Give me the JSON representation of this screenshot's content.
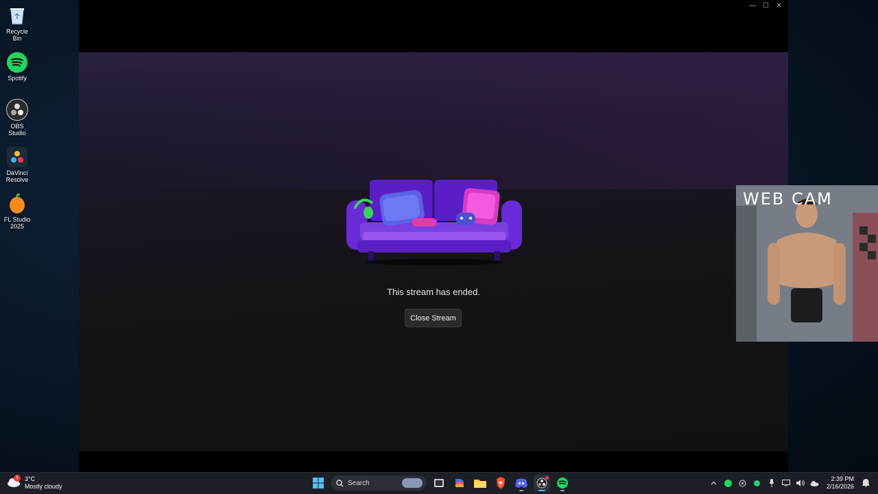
{
  "desktop": {
    "icons": [
      {
        "label": "Recycle Bin",
        "icon": "recycle-bin-icon"
      },
      {
        "label": "Spotify",
        "icon": "spotify-icon"
      },
      {
        "label": "OBS Studio",
        "icon": "obs-studio-icon"
      },
      {
        "label": "DaVinci Resolve",
        "icon": "davinci-resolve-icon"
      },
      {
        "label": "FL Studio 2025",
        "icon": "fl-studio-icon"
      }
    ]
  },
  "window": {
    "controls": {
      "minimize": "—",
      "maximize": "☐",
      "close": "✕"
    },
    "stream": {
      "ended_message": "This stream has ended.",
      "close_button": "Close Stream"
    }
  },
  "webcam": {
    "caption": "WEB CAM"
  },
  "taskbar": {
    "weather": {
      "temp": "3°C",
      "condition": "Mostly cloudy",
      "badge": "1"
    },
    "search_label": "Search",
    "pinned": [
      "windows-start-icon",
      "search-icon",
      "task-view-icon",
      "microsoft-365-icon",
      "file-explorer-icon",
      "brave-icon",
      "discord-icon",
      "obs-studio-icon",
      "spotify-icon"
    ],
    "clock": {
      "time": "2:39 PM",
      "date": "2/16/2026"
    }
  },
  "colors": {
    "accent_purple": "#7b3fd9",
    "spotify_green": "#1ed760",
    "discord_blue": "#5865f2"
  }
}
